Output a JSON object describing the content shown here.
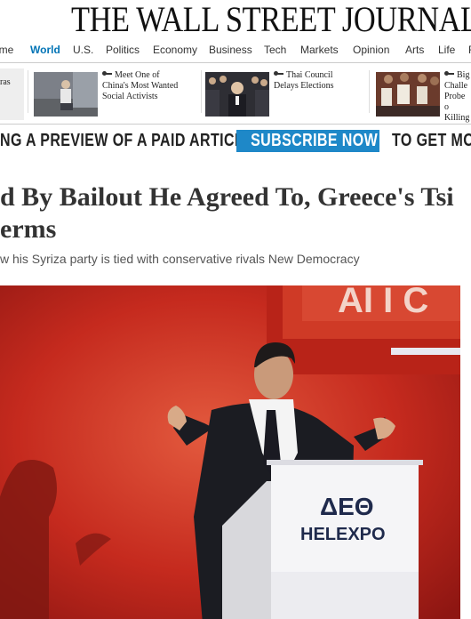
{
  "masthead": {
    "title": "THE WALL STREET JOURNAL."
  },
  "nav": {
    "items": [
      {
        "label": "ome",
        "active": false
      },
      {
        "label": "World",
        "active": true
      },
      {
        "label": "U.S.",
        "active": false
      },
      {
        "label": "Politics",
        "active": false
      },
      {
        "label": "Economy",
        "active": false
      },
      {
        "label": "Business",
        "active": false
      },
      {
        "label": "Tech",
        "active": false
      },
      {
        "label": "Markets",
        "active": false
      },
      {
        "label": "Opinion",
        "active": false
      },
      {
        "label": "Arts",
        "active": false
      },
      {
        "label": "Life",
        "active": false
      },
      {
        "label": "R",
        "active": false
      }
    ]
  },
  "story_strip": {
    "stories": [
      {
        "text": "ras"
      },
      {
        "text": "Meet One of China's Most Wanted Social Activists",
        "line1": "Meet One of",
        "line2": "China's Most Wanted",
        "line3": "Social Activists"
      },
      {
        "text": "Thai Council Delays Elections",
        "line1": "Thai Council",
        "line2": "Delays Elections"
      },
      {
        "line1": "Big",
        "line2": "Challe",
        "line3": "Probe o",
        "line4": "Killing"
      }
    ]
  },
  "promo": {
    "left_text": "NG A PREVIEW OF A PAID ARTICLE.",
    "button_label": "SUBSCRIBE NOW",
    "right_text": "TO GET MOR"
  },
  "article": {
    "headline_line1": "d By Bailout He Agreed To, Greece's Tsi",
    "headline_line2": "erms",
    "subhead": "w his Syriza party is tied with conservative rivals New Democracy"
  },
  "photo": {
    "backdrop_text": "AI I C",
    "podium_logo_top": "ΔΕΘ",
    "podium_logo_bottom_1": "HEL",
    "podium_logo_bottom_2": "EXPO"
  },
  "colors": {
    "accent": "#0274b6",
    "subscribe_bg": "#1e88c8",
    "photo_bg": "#c52a1e"
  }
}
